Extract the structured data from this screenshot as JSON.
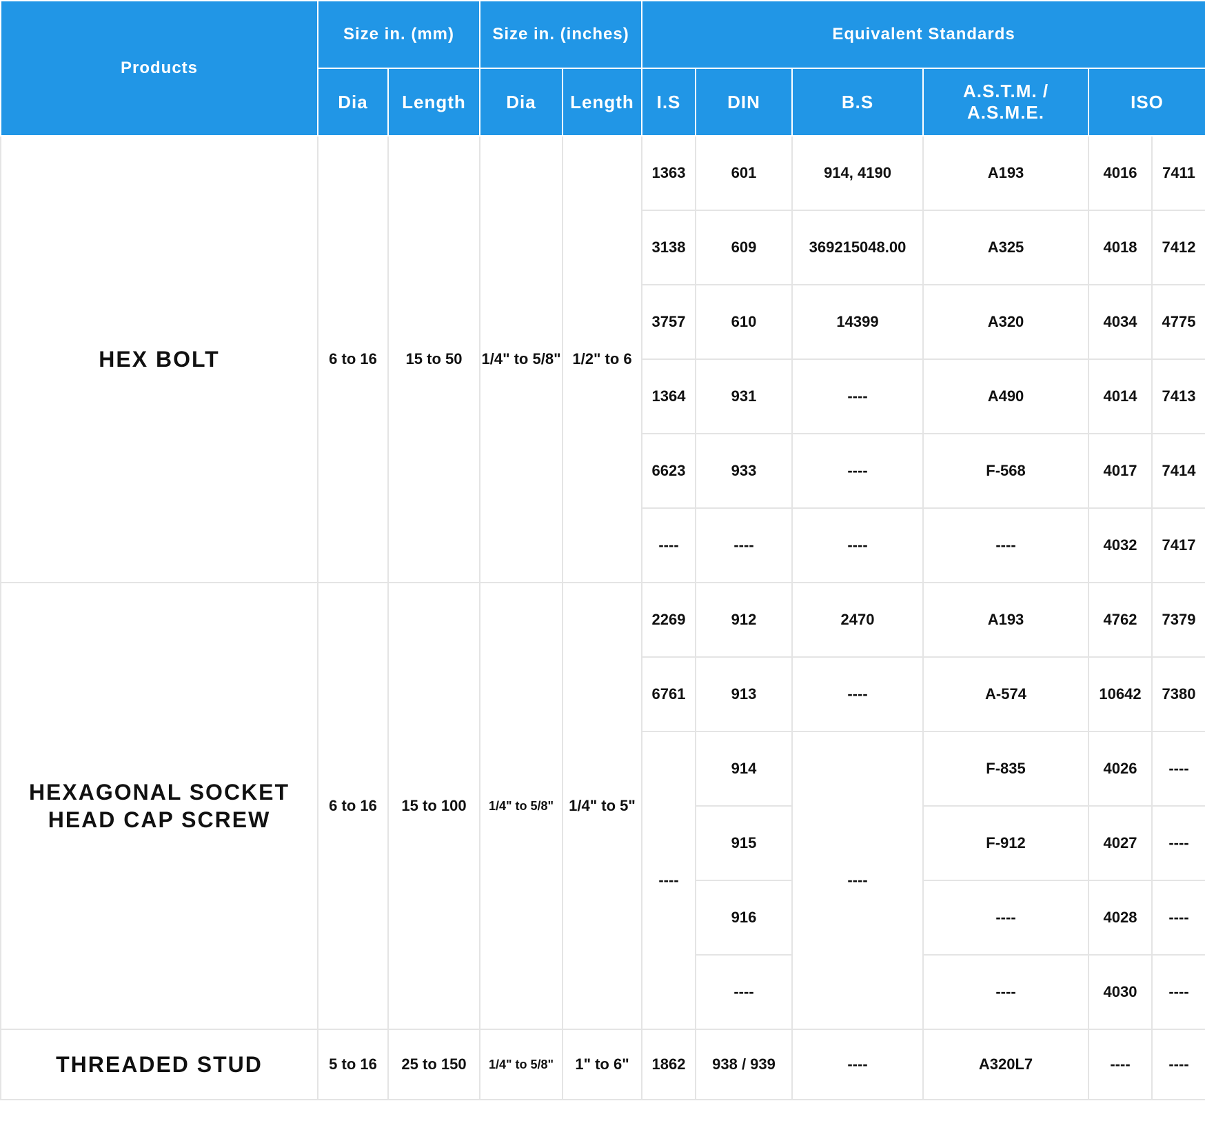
{
  "header": {
    "products": "Products",
    "size_mm": "Size in. (mm)",
    "size_in": "Size in. (inches)",
    "equivalent": "Equivalent Standards",
    "dia_mm": "Dia",
    "len_mm": "Length",
    "dia_in": "Dia",
    "len_in": "Length",
    "is": "I.S",
    "din": "DIN",
    "bs": "B.S",
    "astm": "A.S.T.M. / A.S.M.E.",
    "iso": "ISO"
  },
  "hex_bolt": {
    "name": "HEX BOLT",
    "dia_mm": "6 to 16",
    "len_mm": "15 to 50",
    "dia_in": "1/4\" to 5/8\"",
    "len_in": "1/2\" to 6",
    "rows": [
      {
        "is": "1363",
        "din": "601",
        "bs": "914, 4190",
        "astm": "A193",
        "iso1": "4016",
        "iso2": "7411"
      },
      {
        "is": "3138",
        "din": "609",
        "bs": "369215048.00",
        "astm": "A325",
        "iso1": "4018",
        "iso2": "7412"
      },
      {
        "is": "3757",
        "din": "610",
        "bs": "14399",
        "astm": "A320",
        "iso1": "4034",
        "iso2": "4775"
      },
      {
        "is": "1364",
        "din": "931",
        "bs": "----",
        "astm": "A490",
        "iso1": "4014",
        "iso2": "7413"
      },
      {
        "is": "6623",
        "din": "933",
        "bs": "----",
        "astm": "F-568",
        "iso1": "4017",
        "iso2": "7414"
      },
      {
        "is": "----",
        "din": "----",
        "bs": "----",
        "astm": "----",
        "iso1": "4032",
        "iso2": "7417"
      }
    ]
  },
  "socket_screw": {
    "name_line1": "HEXAGONAL SOCKET",
    "name_line2": "HEAD CAP SCREW",
    "dia_mm": "6 to 16",
    "len_mm": "15 to 100",
    "dia_in": "1/4\" to 5/8\"",
    "len_in": "1/4\" to 5\"",
    "merged_is": "----",
    "merged_bs": "----",
    "rows": [
      {
        "is": "2269",
        "din": "912",
        "bs": "2470",
        "astm": "A193",
        "iso1": "4762",
        "iso2": "7379"
      },
      {
        "is": "6761",
        "din": "913",
        "bs": "----",
        "astm": "A-574",
        "iso1": "10642",
        "iso2": "7380"
      },
      {
        "din": "914",
        "astm": "F-835",
        "iso1": "4026",
        "iso2": "----"
      },
      {
        "din": "915",
        "astm": "F-912",
        "iso1": "4027",
        "iso2": "----"
      },
      {
        "din": "916",
        "astm": "----",
        "iso1": "4028",
        "iso2": "----"
      },
      {
        "din": "----",
        "astm": "----",
        "iso1": "4030",
        "iso2": "----"
      }
    ]
  },
  "threaded_stud": {
    "name": "THREADED STUD",
    "dia_mm": "5 to 16",
    "len_mm": "25 to 150",
    "dia_in": "1/4\" to 5/8\"",
    "len_in": "1\" to 6\"",
    "is": "1862",
    "din": "938 / 939",
    "bs": "----",
    "astm": "A320L7",
    "iso1": "----",
    "iso2": "----"
  },
  "colors": {
    "header_bg": "#2196e6",
    "header_text": "#ffffff",
    "grid": "#e4e4e4"
  }
}
